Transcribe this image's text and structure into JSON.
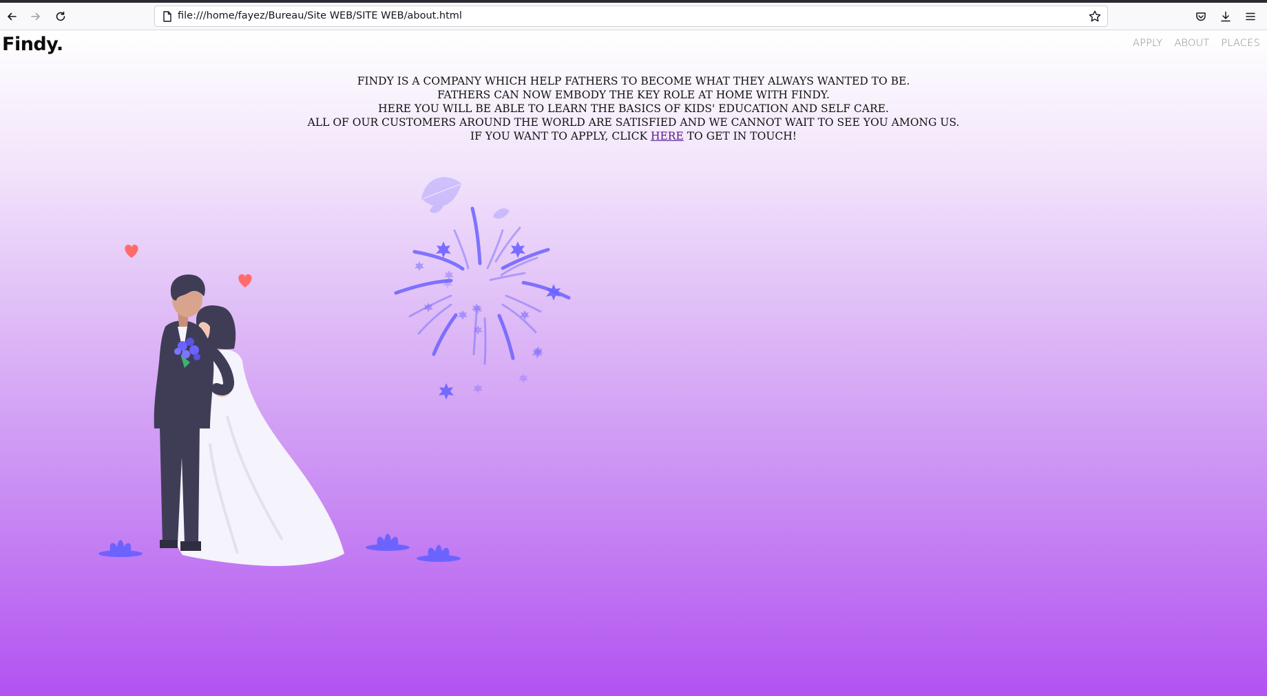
{
  "browser": {
    "url": "file:///home/fayez/Bureau/Site WEB/SITE WEB/about.html",
    "icons": {
      "back": "back-arrow-icon",
      "forward": "forward-arrow-icon",
      "reload": "reload-icon",
      "page": "page-icon",
      "bookmark": "star-icon",
      "pocket": "pocket-icon",
      "downloads": "download-icon",
      "menu": "hamburger-menu-icon"
    }
  },
  "site": {
    "logo": "Findy.",
    "nav": [
      "APPLY",
      "ABOUT",
      "PLACES"
    ]
  },
  "intro": {
    "lines": [
      "FINDY IS A COMPANY WHICH HELP FATHERS TO BECOME WHAT THEY ALWAYS WANTED TO BE.",
      "FATHERS CAN NOW EMBODY THE KEY ROLE AT HOME WITH FINDY.",
      "HERE YOU WILL BE ABLE TO LEARN THE BASICS OF KIDS' EDUCATION AND SELF CARE.",
      "ALL OF OUR CUSTOMERS AROUND THE WORLD ARE SATISFIED AND WE CANNOT WAIT TO SEE YOU AMONG US."
    ],
    "cta_before": "IF YOU WANT TO APPLY, CLICK ",
    "cta_link": "HERE",
    "cta_after": " TO GET IN TOUCH!"
  },
  "colors": {
    "gradient_top": "#ffffff",
    "gradient_bottom": "#b252f2",
    "accent_purple": "#6c63ff",
    "heart": "#ff6b6b",
    "suit": "#3f3d56",
    "link": "#551a8b"
  }
}
